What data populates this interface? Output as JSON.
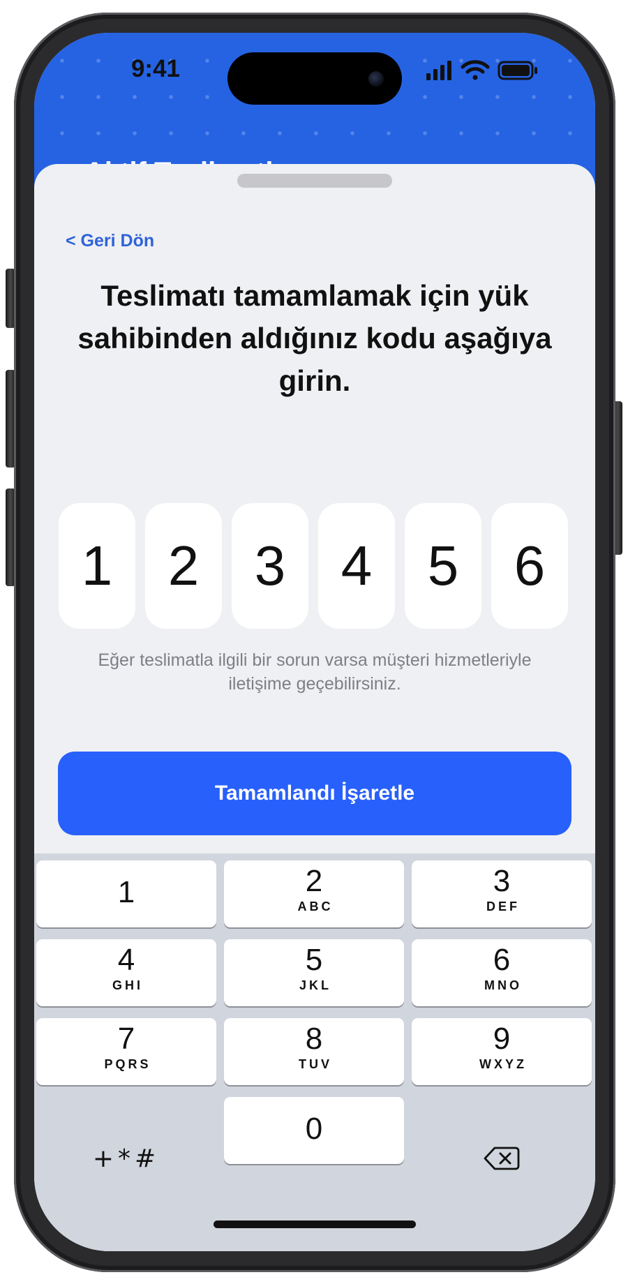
{
  "status_bar": {
    "time": "9:41",
    "signal_icon": "cellular-signal-icon",
    "wifi_icon": "wifi-icon",
    "battery_icon": "battery-icon"
  },
  "header": {
    "title_peek": "Aktif Teslimatlar",
    "color": "#2563e3"
  },
  "sheet": {
    "back_label": "< Geri Dön",
    "instruction": "Teslimatı tamamlamak için yük sahibinden aldığınız kodu aşağıya girin.",
    "code_digits": [
      "1",
      "2",
      "3",
      "4",
      "5",
      "6"
    ],
    "help_text": "Eğer teslimatla ilgili bir sorun varsa müşteri hizmetleriyle iletişime geçebilirsiniz.",
    "complete_button_label": "Tamamlandı İşaretle",
    "button_color": "#2860fb"
  },
  "keypad": {
    "keys": [
      {
        "digit": "1",
        "letters": ""
      },
      {
        "digit": "2",
        "letters": "ABC"
      },
      {
        "digit": "3",
        "letters": "DEF"
      },
      {
        "digit": "4",
        "letters": "GHI"
      },
      {
        "digit": "5",
        "letters": "JKL"
      },
      {
        "digit": "6",
        "letters": "MNO"
      },
      {
        "digit": "7",
        "letters": "PQRS"
      },
      {
        "digit": "8",
        "letters": "TUV"
      },
      {
        "digit": "9",
        "letters": "WXYZ"
      },
      {
        "digit": "0",
        "letters": ""
      }
    ],
    "symbols_label": "+*#",
    "delete_icon": "backspace-icon"
  }
}
